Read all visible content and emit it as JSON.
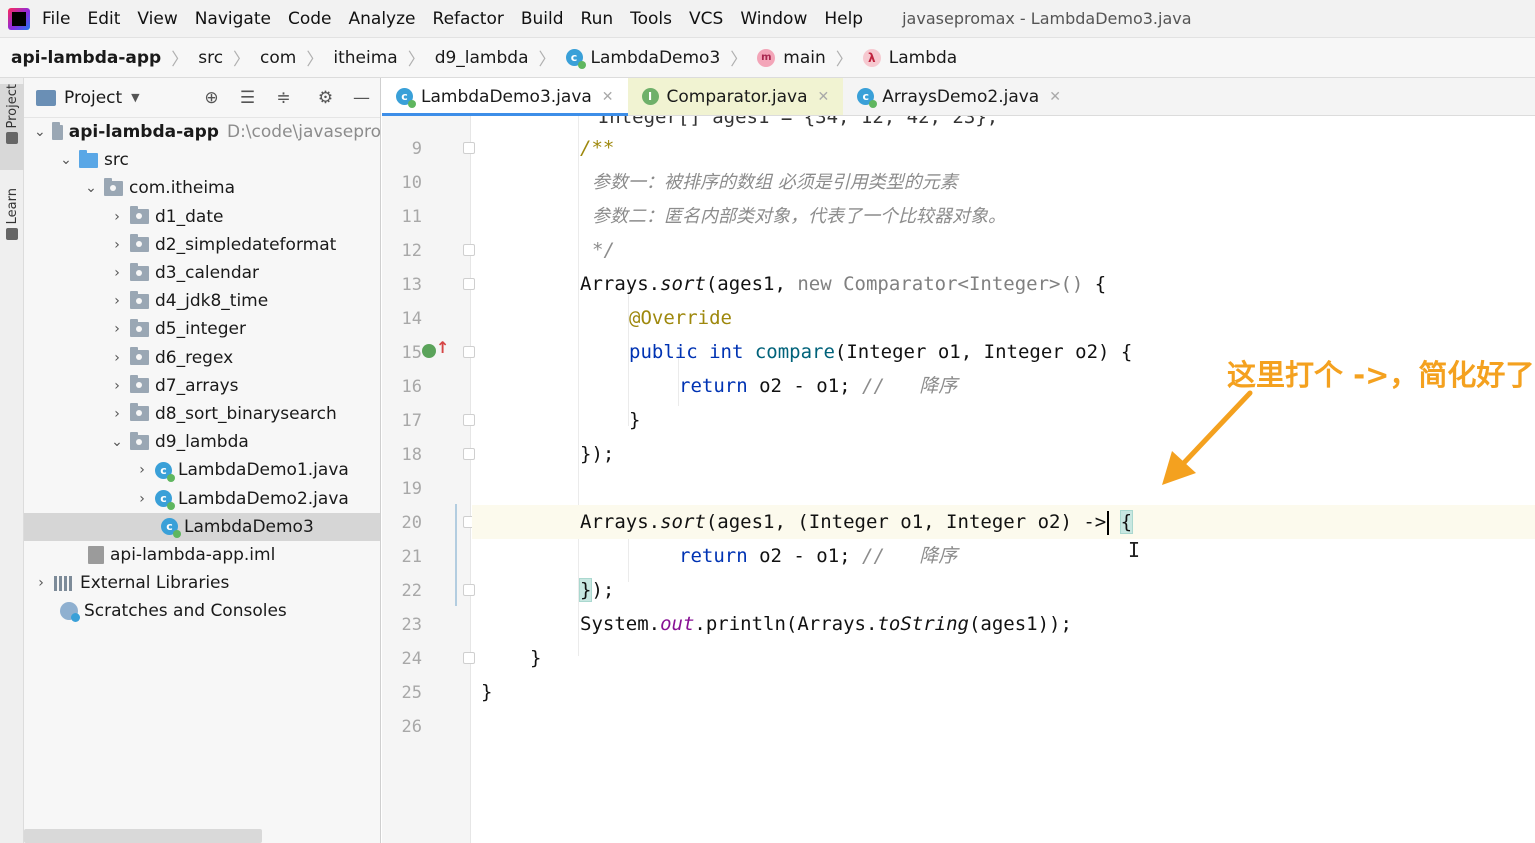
{
  "menubar": {
    "items": [
      "File",
      "Edit",
      "View",
      "Navigate",
      "Code",
      "Analyze",
      "Refactor",
      "Build",
      "Run",
      "Tools",
      "VCS",
      "Window",
      "Help"
    ],
    "window_title": "javasepromax - LambdaDemo3.java"
  },
  "breadcrumb": [
    "api-lambda-app",
    "src",
    "com",
    "itheima",
    "d9_lambda",
    "LambdaDemo3",
    "main",
    "Lambda"
  ],
  "tool_strip": {
    "project": "Project",
    "learn": "Learn"
  },
  "project_panel": {
    "title": "Project",
    "tree": [
      {
        "label": "api-lambda-app",
        "path": "D:\\code\\javasepro"
      },
      {
        "label": "src"
      },
      {
        "label": "com.itheima"
      },
      {
        "label": "d1_date"
      },
      {
        "label": "d2_simpledateformat"
      },
      {
        "label": "d3_calendar"
      },
      {
        "label": "d4_jdk8_time"
      },
      {
        "label": "d5_integer"
      },
      {
        "label": "d6_regex"
      },
      {
        "label": "d7_arrays"
      },
      {
        "label": "d8_sort_binarysearch"
      },
      {
        "label": "d9_lambda"
      },
      {
        "label": "LambdaDemo1.java"
      },
      {
        "label": "LambdaDemo2.java"
      },
      {
        "label": "LambdaDemo3"
      },
      {
        "label": "api-lambda-app.iml"
      },
      {
        "label": "External Libraries"
      },
      {
        "label": "Scratches and Consoles"
      }
    ]
  },
  "tabs": [
    {
      "label": "LambdaDemo3.java",
      "active": true
    },
    {
      "label": "Comparator.java",
      "active": false
    },
    {
      "label": "ArraysDemo2.java",
      "active": false
    }
  ],
  "editor": {
    "line_numbers": [
      "9",
      "10",
      "11",
      "12",
      "13",
      "14",
      "15",
      "16",
      "17",
      "18",
      "19",
      "20",
      "21",
      "22",
      "23",
      "24",
      "25",
      "26"
    ],
    "code": {
      "l9": "/**",
      "l10": "参数一：被排序的数组 必须是引用类型的元素",
      "l11": "参数二：匿名内部类对象，代表了一个比较器对象。",
      "l12": "*/",
      "l13_a": "Arrays.",
      "l13_b": "sort",
      "l13_c": "(ages1, ",
      "l13_d": "new Comparator<Integer>()",
      "l13_e": " {",
      "l14": "@Override",
      "l15_a": "public int ",
      "l15_b": "compare",
      "l15_c": "(Integer o1, Integer o2) {",
      "l16_a": "return",
      "l16_b": " o2 - o1; ",
      "l16_c": "//   降序",
      "l17": "}",
      "l18": "});",
      "l20_a": "Arrays.",
      "l20_b": "sort",
      "l20_c": "(ages1, (Integer o1, Integer o2) ->",
      "l20_d": " ",
      "l20_e": "{",
      "l21_a": "return",
      "l21_b": " o2 - o1; ",
      "l21_c": "//   降序",
      "l22_a": "}",
      "l22_b": ");",
      "l23_a": "System.",
      "l23_b": "out",
      "l23_c": ".println(Arrays.",
      "l23_d": "toString",
      "l23_e": "(ages1));",
      "l24": "}",
      "l25": "}"
    }
  },
  "annotation": {
    "text": "这里打个 ->，简化好了",
    "color": "#f4a11f"
  }
}
